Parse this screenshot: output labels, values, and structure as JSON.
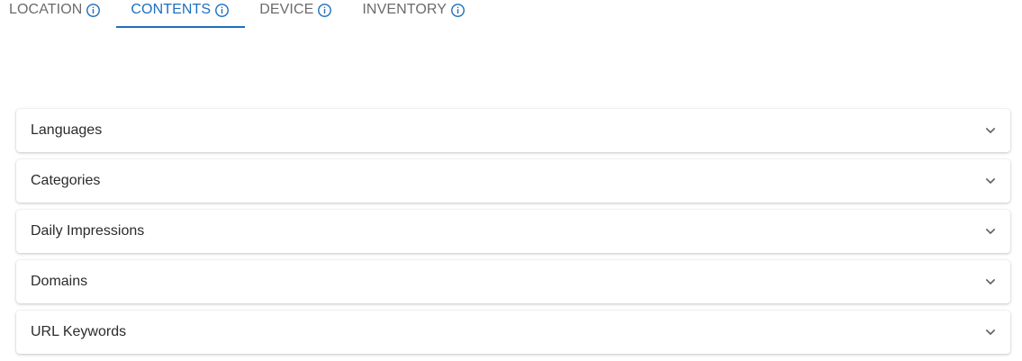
{
  "tabs": [
    {
      "label": "LOCATION",
      "icon": "info-icon",
      "active": false
    },
    {
      "label": "CONTENTS",
      "icon": "info-icon",
      "active": true
    },
    {
      "label": "DEVICE",
      "icon": "info-icon",
      "active": false
    },
    {
      "label": "INVENTORY",
      "icon": "info-icon",
      "active": false
    }
  ],
  "panels": [
    {
      "label": "Languages",
      "icon": "chevron-down-icon"
    },
    {
      "label": "Categories",
      "icon": "chevron-down-icon"
    },
    {
      "label": "Daily Impressions",
      "icon": "chevron-down-icon"
    },
    {
      "label": "Domains",
      "icon": "chevron-down-icon"
    },
    {
      "label": "URL Keywords",
      "icon": "chevron-down-icon"
    }
  ],
  "colors": {
    "accent": "#1e6fbd",
    "tab_text": "#6b6b6b",
    "panel_text": "#2b2b2b"
  }
}
